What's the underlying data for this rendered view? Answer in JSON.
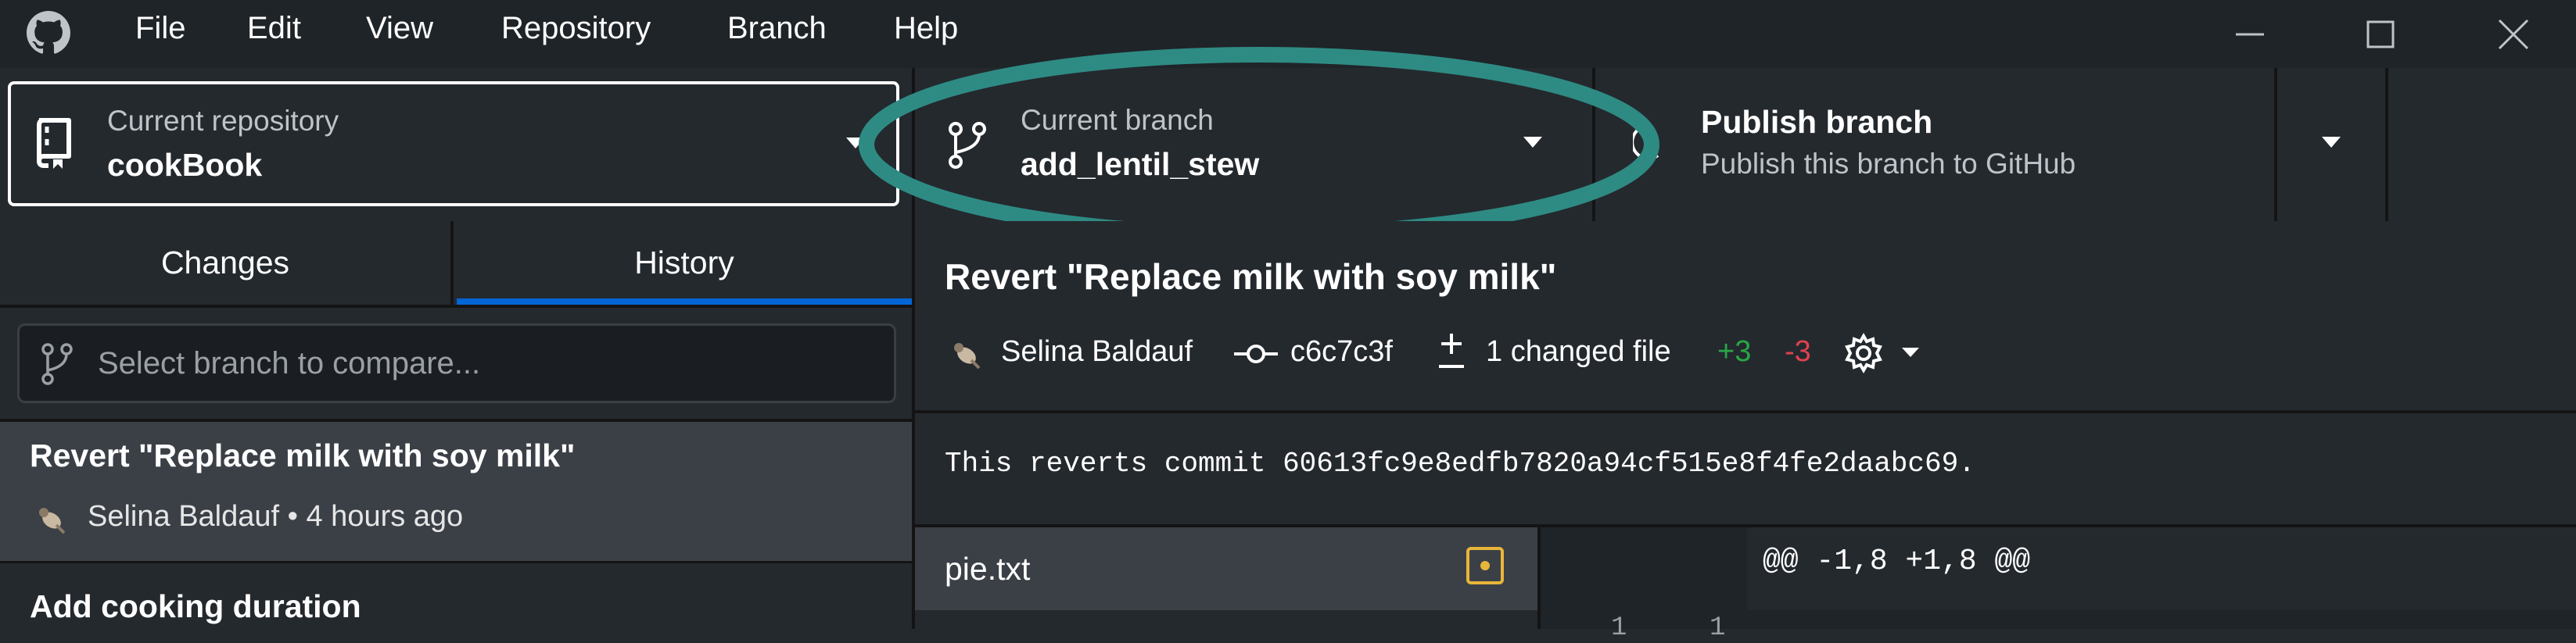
{
  "menu": {
    "items": [
      "File",
      "Edit",
      "View",
      "Repository",
      "Branch",
      "Help"
    ],
    "app_icon": "github-logo-icon"
  },
  "toolbar": {
    "repo": {
      "label": "Current repository",
      "name": "cookBook",
      "icon": "repo-icon"
    },
    "branch": {
      "label": "Current branch",
      "name": "add_lentil_stew",
      "icon": "branch-icon"
    },
    "publish": {
      "title": "Publish branch",
      "subtitle": "Publish this branch to GitHub",
      "icon": "publish-icon"
    }
  },
  "sidebar": {
    "tabs": [
      {
        "label": "Changes",
        "selected": false
      },
      {
        "label": "History",
        "selected": true
      }
    ],
    "compare_placeholder": "Select branch to compare...",
    "commits": [
      {
        "title": "Revert \"Replace milk with soy milk\"",
        "author": "Selina Baldauf",
        "age": "4 hours ago",
        "meta": "Selina Baldauf • 4 hours ago",
        "selected": true
      },
      {
        "title": "Add cooking duration"
      }
    ]
  },
  "commit_detail": {
    "title": "Revert \"Replace milk with soy milk\"",
    "author": "Selina Baldauf",
    "sha": "c6c7c3f",
    "changed_files": "1 changed file",
    "additions": "+3",
    "deletions": "-3",
    "message": "This reverts commit 60613fc9e8edfb7820a94cf515e8f4fe2daabc69.",
    "files": [
      {
        "name": "pie.txt",
        "status": "modified"
      }
    ],
    "diff": {
      "hunk_header": "@@ -1,8 +1,8 @@",
      "old_line": "1",
      "new_line": "1"
    }
  },
  "colors": {
    "accent_blue": "#0366d6",
    "annotation_teal": "#2e8b84",
    "added_green": "#28a745",
    "deleted_red": "#e0424f",
    "modified_yellow": "#e8b53a"
  }
}
